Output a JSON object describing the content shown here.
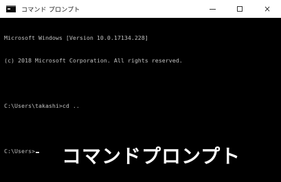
{
  "window": {
    "title": "コマンド プロンプト",
    "controls": {
      "minimize": "–",
      "maximize": "□",
      "close": "×"
    }
  },
  "console": {
    "lines": [
      "Microsoft Windows [Version 10.0.17134.228]",
      "(c) 2018 Microsoft Corporation. All rights reserved.",
      "",
      "C:\\Users\\takashi>cd ..",
      "",
      "C:\\Users>"
    ]
  },
  "caption": "コマンドプロンプト",
  "colors": {
    "background": "#000000",
    "text": "#c0c0c0",
    "titlebar": "#ffffff"
  }
}
